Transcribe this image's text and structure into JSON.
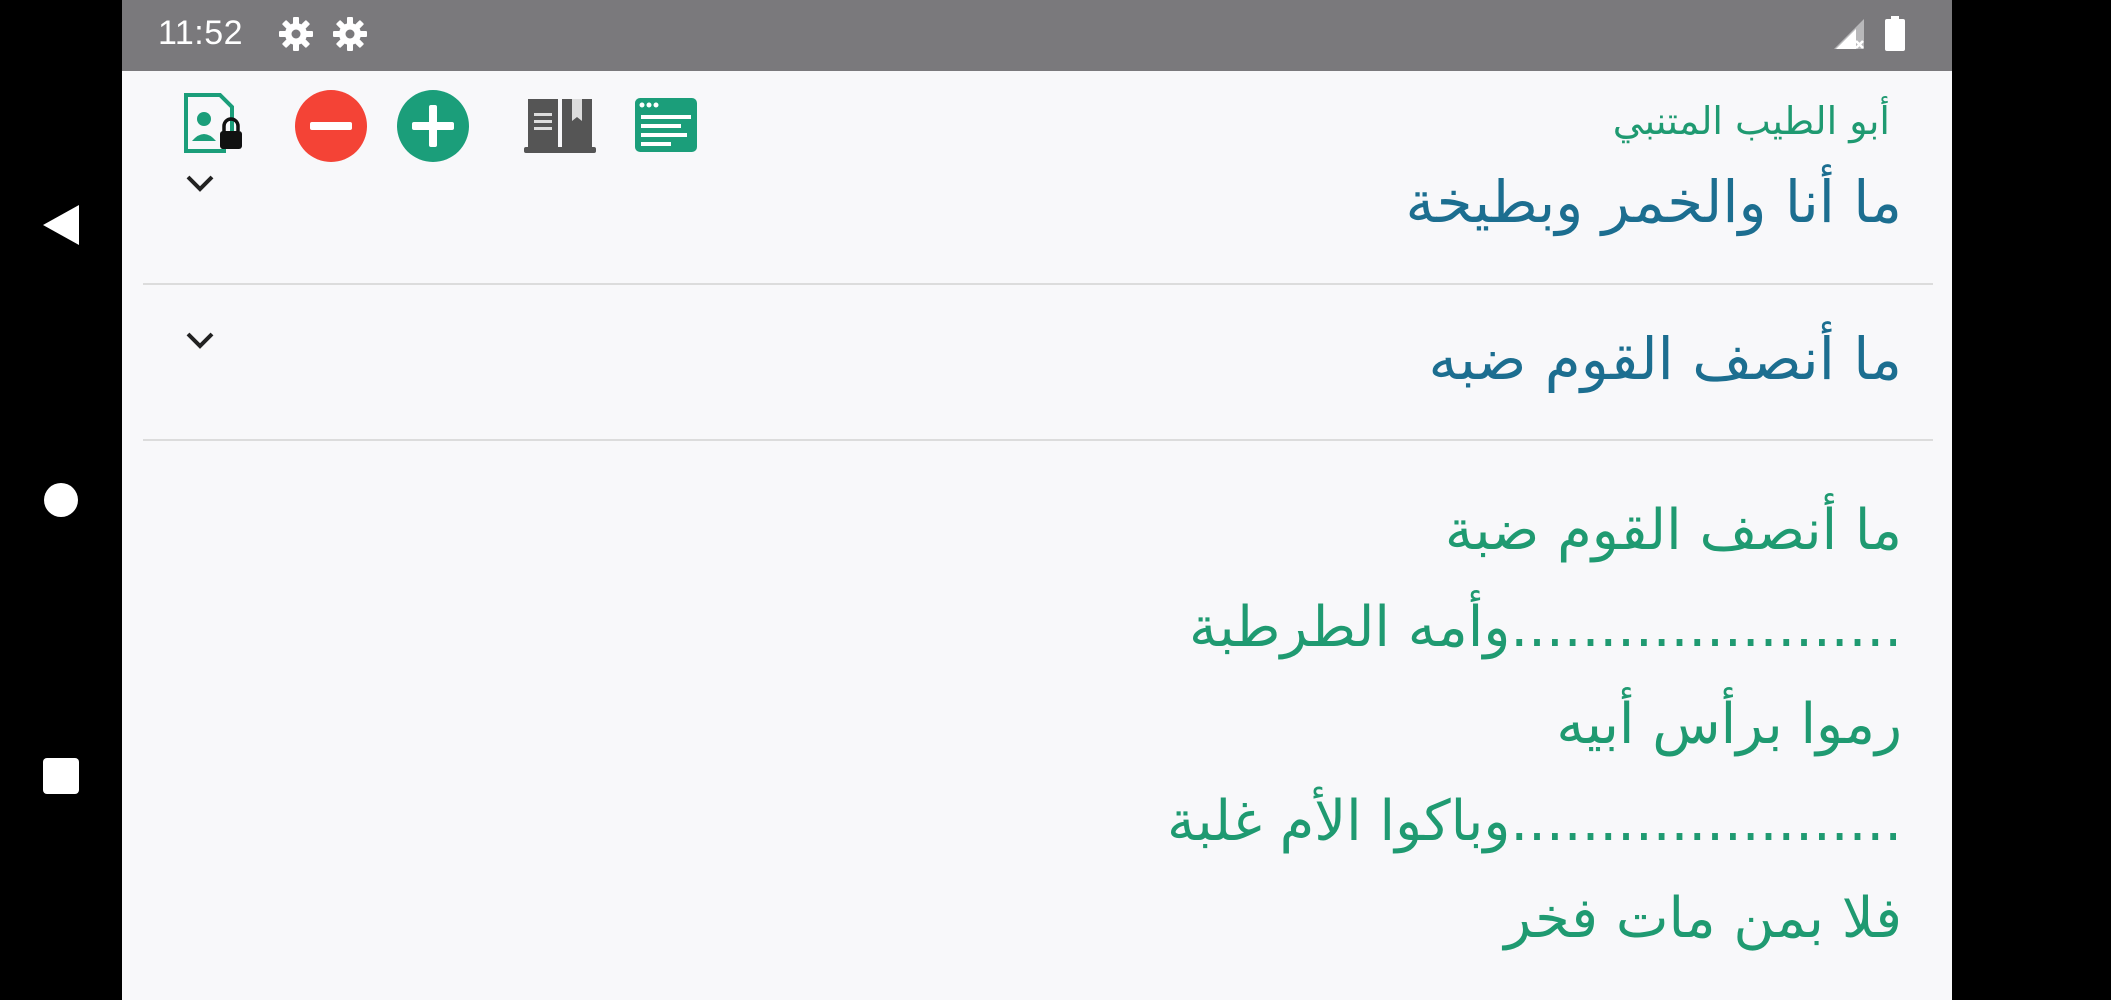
{
  "status_bar": {
    "time": "11:52",
    "icons": [
      "gear-icon",
      "gear-icon",
      "signal-icon",
      "battery-icon"
    ]
  },
  "toolbar": {
    "poet_name": "أبو الطيب المتنبي",
    "icons": [
      "lock-profile-icon",
      "minus-icon",
      "plus-icon",
      "book-icon",
      "browser-window-icon"
    ],
    "colors": {
      "minus": "#f44336",
      "plus": "#1b9e7a",
      "window": "#1b9e7a",
      "book": "#555555"
    }
  },
  "list": {
    "items": [
      {
        "title": "ما أنا والخمر وبطيخة"
      },
      {
        "title": "ما أنصف القوم ضبه"
      }
    ]
  },
  "poem": {
    "lines": [
      "ما أنصف القوم ضبة",
      "......................وأمه الطرطبة",
      "رموا برأس أبيه",
      "......................وباكوا الأم غلبة",
      "فلا بمن مات فخر"
    ]
  },
  "navigation": {
    "icons": [
      "back-icon",
      "home-icon",
      "recents-icon"
    ]
  }
}
